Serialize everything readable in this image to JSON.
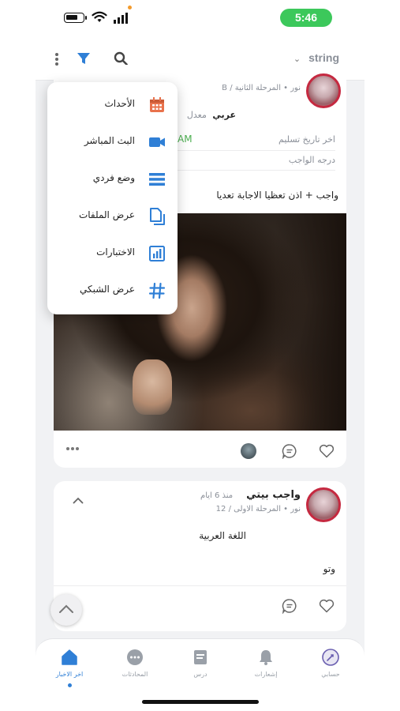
{
  "status_bar": {
    "time": "5:46",
    "colors": {
      "time_pill": "#3cc85b",
      "notice_dot": "#f39a2c"
    }
  },
  "toolbar": {
    "selector_value": "string",
    "icons": [
      "more-vertical-icon",
      "filter-icon",
      "search-icon",
      "chevron-down-icon"
    ],
    "accent": "#2f7fd6"
  },
  "menu": {
    "items": [
      {
        "label": "الأحداث",
        "icon": "calendar-icon",
        "color": "#e9724c"
      },
      {
        "label": "البث المباشر",
        "icon": "video-camera-icon",
        "color": "#2f7fd6"
      },
      {
        "label": "وضع فردي",
        "icon": "list-view-icon",
        "color": "#2f7fd6"
      },
      {
        "label": "عرض الملفات",
        "icon": "files-icon",
        "color": "#2f7fd6"
      },
      {
        "label": "الاختبارات",
        "icon": "bar-chart-icon",
        "color": "#2f7fd6"
      },
      {
        "label": "عرض الشبكي",
        "icon": "grid-hash-icon",
        "color": "#2f7fd6"
      }
    ]
  },
  "post1": {
    "meta": "نور • المرحلة الثانية / B",
    "subject": "عربي",
    "avg_label": "معدل",
    "last_submit_label": "اخر تاريخ تسليم",
    "last_submit_value": "AM",
    "grade_label": "درجه الواجب",
    "title": "واجب + اذن تعظيا الاجابة تعديا"
  },
  "post2": {
    "author": "واجب بيتي",
    "since": "منذ 6 ايام",
    "meta": "نور • المرحلة الاولى / 12",
    "subject": "اللغة العربية",
    "body": "وتو"
  },
  "bottom_nav": {
    "items": [
      {
        "label": "اخر الاخبار",
        "icon": "home-icon",
        "active": true
      },
      {
        "label": "المحادثات",
        "icon": "chat-icon",
        "active": false
      },
      {
        "label": "درس",
        "icon": "lesson-icon",
        "active": false
      },
      {
        "label": "إشعارات",
        "icon": "bell-icon",
        "active": false
      },
      {
        "label": "حسابي",
        "icon": "account-icon",
        "active": false
      }
    ]
  }
}
